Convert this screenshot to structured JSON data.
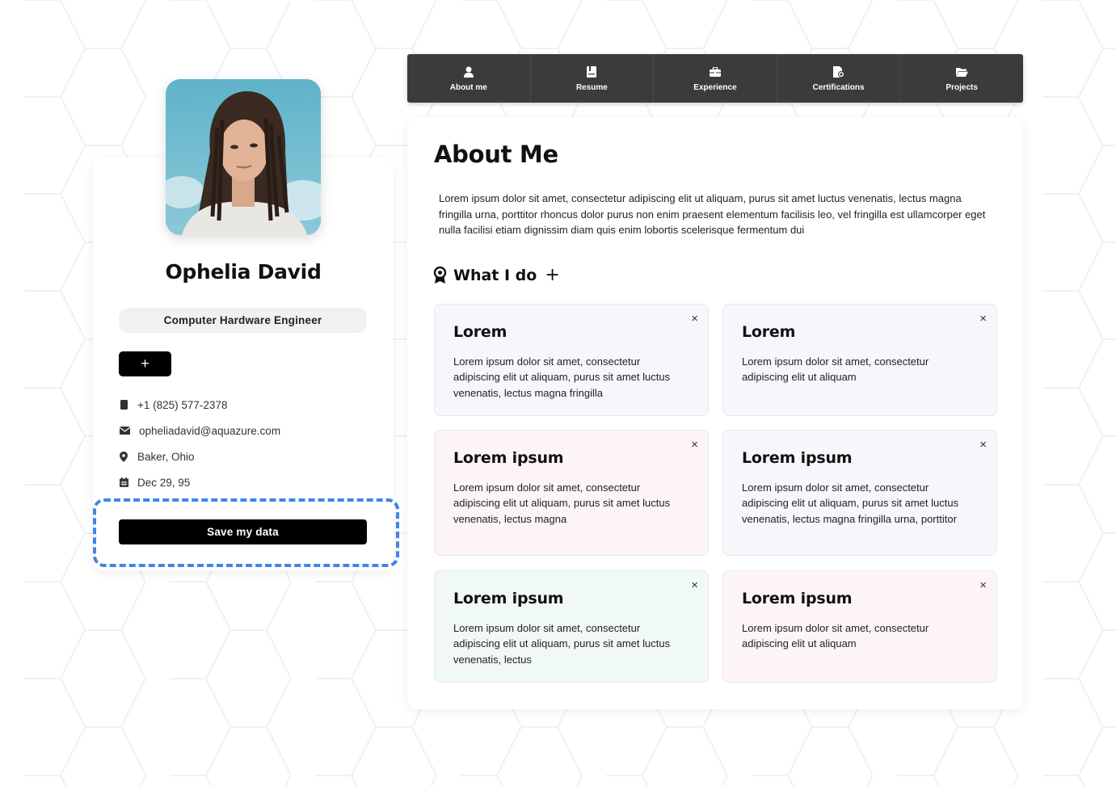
{
  "profile": {
    "name": "Ophelia David",
    "role": "Computer Hardware Engineer",
    "add_label": "+",
    "phone": "+1 (825) 577-2378",
    "email": "opheliadavid@aquazure.com",
    "location": "Baker, Ohio",
    "birthday": "Dec 29, 95",
    "save_label": "Save my data"
  },
  "nav": {
    "items": [
      {
        "label": "About me",
        "icon": "user-icon"
      },
      {
        "label": "Resume",
        "icon": "resume-icon"
      },
      {
        "label": "Experience",
        "icon": "briefcase-icon"
      },
      {
        "label": "Certifications",
        "icon": "certificate-icon"
      },
      {
        "label": "Projects",
        "icon": "folder-icon"
      }
    ]
  },
  "about": {
    "title": "About Me",
    "text": "Lorem ipsum dolor sit amet, consectetur adipiscing elit ut aliquam, purus sit amet luctus venenatis, lectus magna fringilla urna, porttitor rhoncus dolor purus non enim praesent elementum facilisis leo, vel fringilla est ullamcorper eget nulla facilisi etiam dignissim diam quis enim lobortis scelerisque fermentum dui"
  },
  "what_i_do": {
    "title": "What I do",
    "add_label": "+",
    "close_label": "×",
    "cards": [
      {
        "title": "Lorem",
        "text": "Lorem ipsum dolor sit amet, consectetur adipiscing elit ut aliquam, purus sit amet luctus venenatis, lectus magna fringilla",
        "bg": "#f7f6fd"
      },
      {
        "title": "Lorem",
        "text": "Lorem ipsum dolor sit amet, consectetur adipiscing elit ut aliquam",
        "bg": "#f6f6fb"
      },
      {
        "title": "Lorem ipsum",
        "text": "Lorem ipsum dolor sit amet, consectetur adipiscing elit ut aliquam, purus sit amet luctus venenatis, lectus magna",
        "bg": "#fdf4f8"
      },
      {
        "title": "Lorem ipsum",
        "text": "Lorem ipsum dolor sit amet, consectetur adipiscing elit ut aliquam, purus sit amet luctus venenatis, lectus magna fringilla urna, porttitor",
        "bg": "#f6f6fb"
      },
      {
        "title": "Lorem ipsum",
        "text": "Lorem ipsum dolor sit amet, consectetur adipiscing elit ut aliquam, purus sit amet luctus venenatis, lectus",
        "bg": "#f1f9f8"
      },
      {
        "title": "Lorem ipsum",
        "text": "Lorem ipsum dolor sit amet, consectetur adipiscing elit ut aliquam",
        "bg": "#fdf4f8"
      }
    ]
  },
  "colors": {
    "highlight": "#3f86e6",
    "nav_bg": "#3b3b3b"
  }
}
